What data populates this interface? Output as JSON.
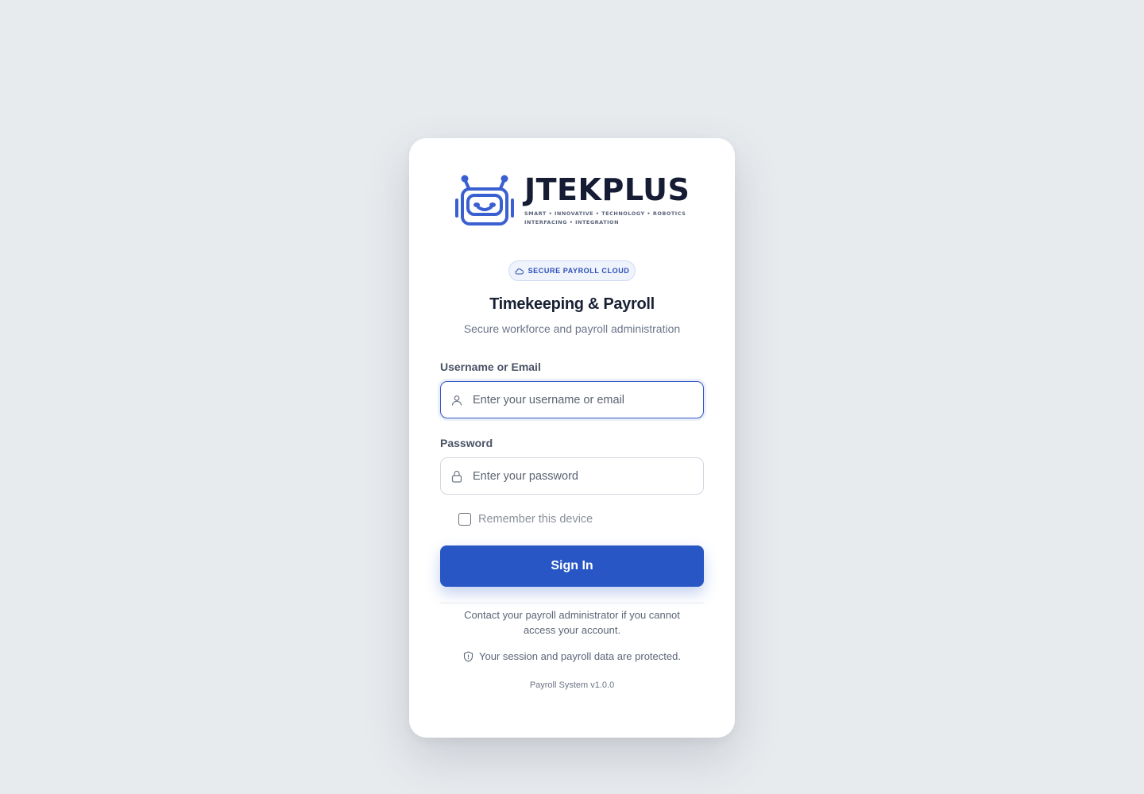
{
  "brand": {
    "name": "JTEKPLUS",
    "tagline_line1": "SMART • INNOVATIVE • TECHNOLOGY • ROBOTICS",
    "tagline_line2": "INTERFACING • INTEGRATION"
  },
  "badge": {
    "icon": "cloud-icon",
    "label": "SECURE PAYROLL CLOUD"
  },
  "header": {
    "title": "Timekeeping & Payroll",
    "subtitle": "Secure workforce and payroll administration"
  },
  "form": {
    "username": {
      "label": "Username or Email",
      "placeholder": "Enter your username or email",
      "value": "",
      "icon": "user-icon"
    },
    "password": {
      "label": "Password",
      "placeholder": "Enter your password",
      "value": "",
      "icon": "lock-icon"
    },
    "remember": {
      "label": "Remember this device",
      "checked": false
    },
    "submit_label": "Sign In"
  },
  "footer": {
    "help_text": "Contact your payroll administrator if you cannot access your account.",
    "protection_text": "Your session and payroll data are protected.",
    "protection_icon": "shield-icon",
    "version": "Payroll System v1.0.0"
  },
  "colors": {
    "background": "#e8ebee",
    "accent": "#2857c5",
    "logo_blue": "#3a5fd0",
    "text_dark": "#182033"
  }
}
